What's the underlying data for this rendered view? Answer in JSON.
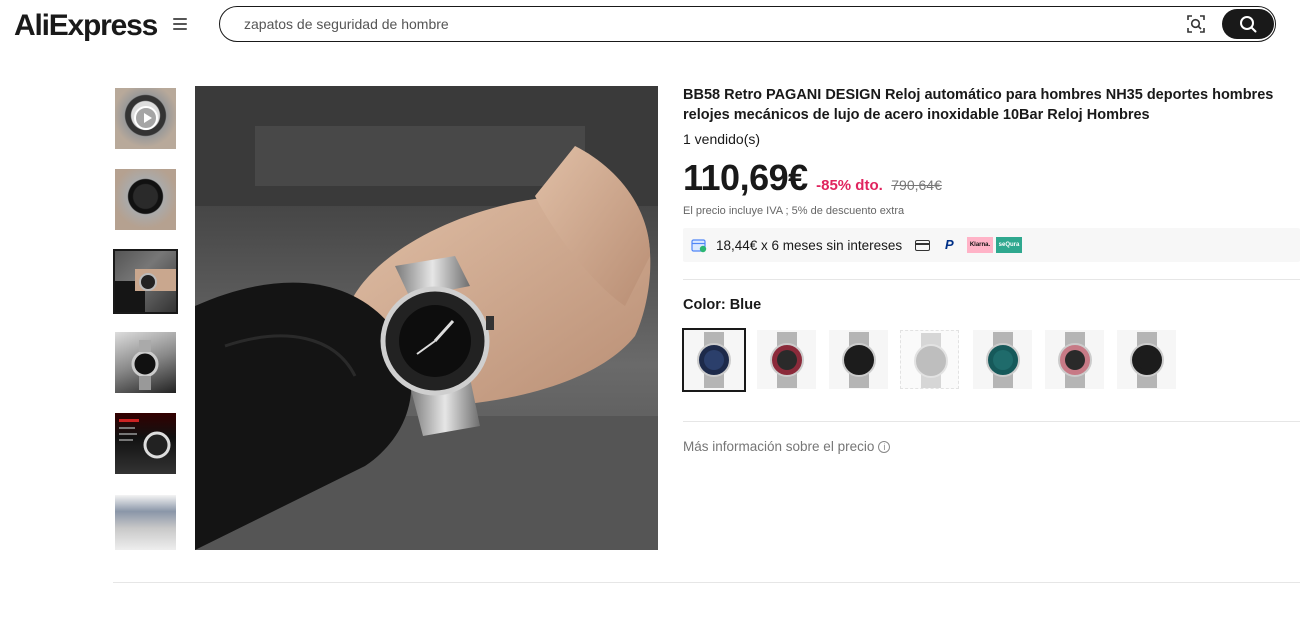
{
  "header": {
    "logo_text": "AliExpress",
    "search_value": "zapatos de seguridad de hombre",
    "icons": [
      "menu-icon",
      "camera-search-icon",
      "search-icon"
    ]
  },
  "gallery": {
    "thumbnails": [
      {
        "label": "video",
        "active": false
      },
      {
        "label": "watch-front",
        "active": false
      },
      {
        "label": "watch-on-wrist",
        "active": true
      },
      {
        "label": "watch-side",
        "active": false
      },
      {
        "label": "watch-specs",
        "active": false
      },
      {
        "label": "watch-bracelet",
        "active": false
      }
    ]
  },
  "product": {
    "title": "BB58 Retro PAGANI DESIGN Reloj automático para hombres NH35 deportes hombres relojes mecánicos de lujo de acero inoxidable 10Bar Reloj Hombres",
    "sold": "1 vendido(s)",
    "price": "110,69€",
    "discount": "-85% dto.",
    "original_price": "790,64€",
    "tax_note": "El precio incluye IVA ; 5% de descuento extra",
    "installments": "18,44€ x 6 meses sin intereses",
    "payment_methods": {
      "paypal": "P",
      "klarna": "Klarna.",
      "sequra": "seQura"
    },
    "color_label": "Color: Blue",
    "colors": [
      {
        "name": "Blue",
        "dial": "#2b3f6b",
        "bezel": "#1d2a4a",
        "selected": true,
        "available": true
      },
      {
        "name": "Red Black",
        "dial": "#2a2a2a",
        "bezel": "#8b2a3a",
        "selected": false,
        "available": true
      },
      {
        "name": "Black Gold",
        "dial": "#1c1c1c",
        "bezel": "#1c1c1c",
        "selected": false,
        "available": true
      },
      {
        "name": "Silver",
        "dial": "#8a8a8a",
        "bezel": "#8a8a8a",
        "selected": false,
        "available": false
      },
      {
        "name": "Green",
        "dial": "#1f6b6b",
        "bezel": "#16595a",
        "selected": false,
        "available": true
      },
      {
        "name": "Pink",
        "dial": "#2a2a2a",
        "bezel": "#c77a86",
        "selected": false,
        "available": true
      },
      {
        "name": "Black",
        "dial": "#1c1c1c",
        "bezel": "#1c1c1c",
        "selected": false,
        "available": true
      }
    ],
    "more_info": "Más información sobre el precio",
    "info_icon_glyph": "i"
  },
  "colors": {
    "accent_discount": "#e0245e",
    "text_primary": "#191919",
    "text_muted": "#767676"
  }
}
